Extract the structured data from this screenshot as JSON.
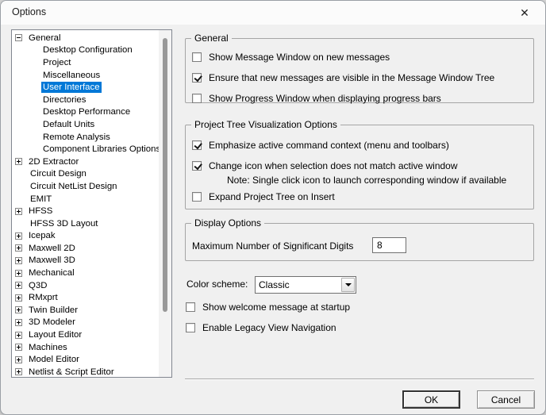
{
  "window": {
    "title": "Options",
    "close_icon": "✕"
  },
  "tree": {
    "selection_color": "#0078d7",
    "items": [
      {
        "label": "General",
        "level": 0,
        "expander": "minus"
      },
      {
        "label": "Desktop Configuration",
        "level": 1
      },
      {
        "label": "Project",
        "level": 1
      },
      {
        "label": "Miscellaneous",
        "level": 1
      },
      {
        "label": "User Interface",
        "level": 1,
        "selected": true
      },
      {
        "label": "Directories",
        "level": 1
      },
      {
        "label": "Desktop Performance",
        "level": 1
      },
      {
        "label": "Default Units",
        "level": 1
      },
      {
        "label": "Remote Analysis",
        "level": 1
      },
      {
        "label": "Component Libraries Options",
        "level": 1
      },
      {
        "label": "2D Extractor",
        "level": 0,
        "expander": "plus"
      },
      {
        "label": "Circuit Design",
        "level": 0
      },
      {
        "label": "Circuit NetList Design",
        "level": 0
      },
      {
        "label": "EMIT",
        "level": 0
      },
      {
        "label": "HFSS",
        "level": 0,
        "expander": "plus"
      },
      {
        "label": "HFSS 3D Layout",
        "level": 0
      },
      {
        "label": "Icepak",
        "level": 0,
        "expander": "plus"
      },
      {
        "label": "Maxwell 2D",
        "level": 0,
        "expander": "plus"
      },
      {
        "label": "Maxwell 3D",
        "level": 0,
        "expander": "plus"
      },
      {
        "label": "Mechanical",
        "level": 0,
        "expander": "plus"
      },
      {
        "label": "Q3D",
        "level": 0,
        "expander": "plus"
      },
      {
        "label": "RMxprt",
        "level": 0,
        "expander": "plus"
      },
      {
        "label": "Twin Builder",
        "level": 0,
        "expander": "plus"
      },
      {
        "label": "3D Modeler",
        "level": 0,
        "expander": "plus"
      },
      {
        "label": "Layout Editor",
        "level": 0,
        "expander": "plus"
      },
      {
        "label": "Machines",
        "level": 0,
        "expander": "plus"
      },
      {
        "label": "Model Editor",
        "level": 0,
        "expander": "plus"
      },
      {
        "label": "Netlist & Script Editor",
        "level": 0,
        "expander": "plus"
      }
    ]
  },
  "groups": {
    "general": {
      "title": "General",
      "checkboxes": [
        {
          "label": "Show Message Window on new messages",
          "checked": false
        },
        {
          "label": "Ensure that new messages are visible in the Message Window Tree",
          "checked": true
        },
        {
          "label": "Show Progress Window when displaying progress bars",
          "checked": false
        }
      ]
    },
    "project_tree": {
      "title": "Project Tree Visualization Options",
      "checkboxes": [
        {
          "label": "Emphasize active command context (menu and toolbars)",
          "checked": true
        },
        {
          "label": "Change icon when selection does not match active window",
          "checked": true
        },
        {
          "label": "Expand Project Tree on Insert",
          "checked": false
        }
      ],
      "note": "Note: Single click icon to launch corresponding window if available"
    },
    "display": {
      "title": "Display Options",
      "field_label": "Maximum Number of Significant Digits",
      "field_value": "8"
    }
  },
  "misc": {
    "color_scheme_label": "Color scheme:",
    "color_scheme_value": "Classic",
    "welcome_checkbox": {
      "label": "Show welcome message at startup",
      "checked": false
    },
    "legacy_checkbox": {
      "label": "Enable Legacy View Navigation",
      "checked": false
    }
  },
  "footer": {
    "ok_label": "OK",
    "cancel_label": "Cancel"
  }
}
